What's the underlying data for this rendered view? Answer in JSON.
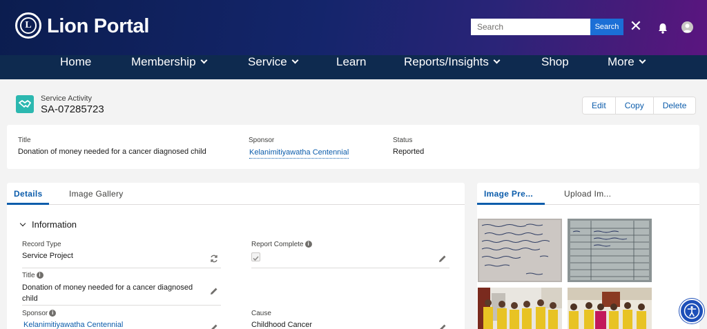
{
  "header": {
    "brand": "Lion Portal",
    "logo_letter": "L",
    "search_placeholder": "Search",
    "search_button": "Search",
    "close_glyph": "✕"
  },
  "nav": {
    "items": [
      {
        "label": "Home",
        "dropdown": false
      },
      {
        "label": "Membership",
        "dropdown": true
      },
      {
        "label": "Service",
        "dropdown": true
      },
      {
        "label": "Learn",
        "dropdown": false
      },
      {
        "label": "Reports/Insights",
        "dropdown": true
      },
      {
        "label": "Shop",
        "dropdown": false
      },
      {
        "label": "More",
        "dropdown": true
      }
    ]
  },
  "record": {
    "type": "Service Activity",
    "id": "SA-07285723",
    "actions": [
      "Edit",
      "Copy",
      "Delete"
    ]
  },
  "highlights": {
    "title_label": "Title",
    "title_value": "Donation of money needed for a cancer diagnosed child",
    "sponsor_label": "Sponsor",
    "sponsor_value": "Kelanimitiyawatha Centennial",
    "status_label": "Status",
    "status_value": "Reported"
  },
  "details": {
    "tabs": [
      "Details",
      "Image Gallery"
    ],
    "section": "Information",
    "record_type_label": "Record Type",
    "record_type_value": "Service Project",
    "report_complete_label": "Report Complete",
    "title_label": "Title",
    "title_value_line1": "Donation of money needed for a cancer diagnosed",
    "title_value_line2": "child",
    "sponsor_label": "Sponsor",
    "sponsor_value": "Kelanimitiyawatha Centennial",
    "cause_label": "Cause",
    "cause_value": "Childhood Cancer"
  },
  "side": {
    "tabs": [
      "Image Pre...",
      "Upload Im..."
    ]
  },
  "colors": {
    "accent": "#0b5cab",
    "nav_bg": "#0e2a4f",
    "icon_teal": "#2cb8b0",
    "search_blue": "#1b6fd6"
  }
}
